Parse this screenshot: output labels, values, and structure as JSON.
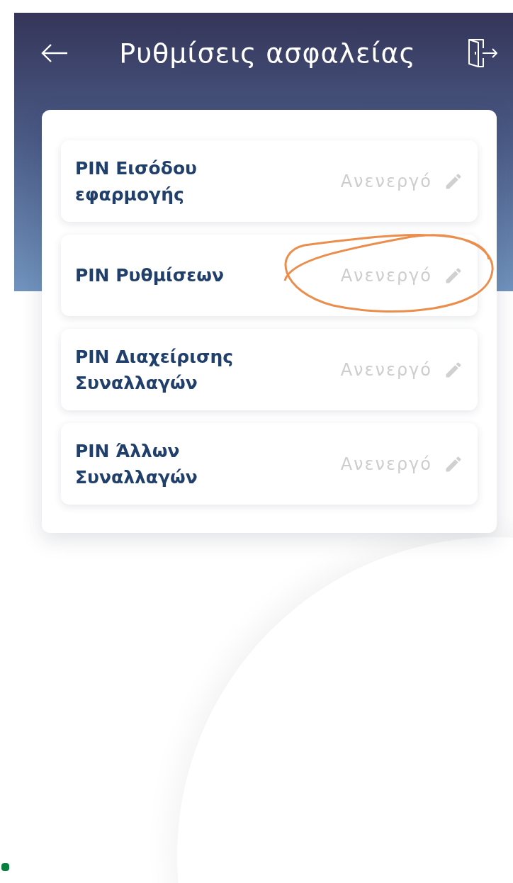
{
  "header": {
    "title": "Ρυθμίσεις ασφαλείας"
  },
  "pins": [
    {
      "label": "PIN Εισόδου εφαρμογής",
      "status": "Ανενεργό",
      "circled": false
    },
    {
      "label": "PIN Ρυθμίσεων",
      "status": "Ανενεργό",
      "circled": true
    },
    {
      "label": "PIN Διαχείρισης Συναλλαγών",
      "status": "Ανενεργό",
      "circled": false
    },
    {
      "label": "PIN Άλλων Συναλλαγών",
      "status": "Ανενεργό",
      "circled": false
    }
  ]
}
